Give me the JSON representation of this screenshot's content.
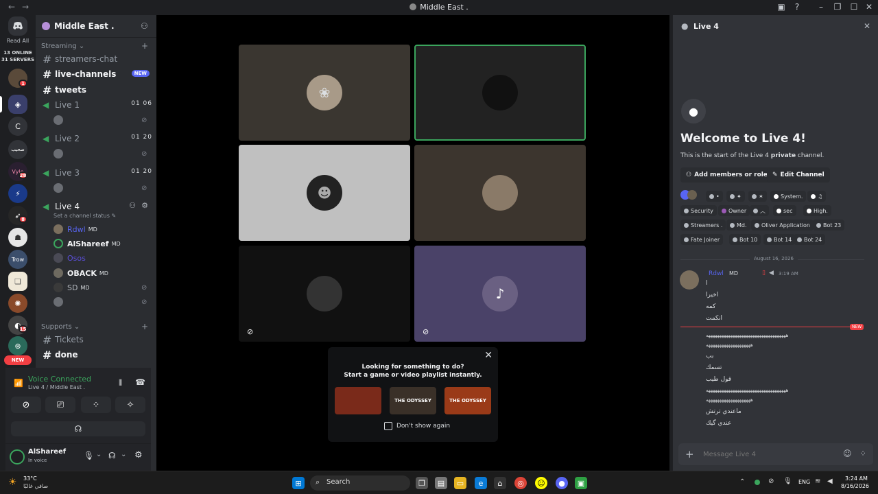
{
  "window": {
    "title": "Middle East .",
    "back": "←",
    "forward": "→"
  },
  "rail": {
    "read_all": "Read All",
    "online": "13 ONLINE",
    "servers": "31 SERVERS",
    "badges": [
      "1",
      "28",
      "8",
      "15"
    ],
    "c_label": "C",
    "arabic_label": "صحيب",
    "trow_label": "Trow",
    "new_label": "NEW"
  },
  "sidebar": {
    "guild_name": "Middle East .",
    "categories": {
      "streaming": "Streaming",
      "supports": "Supports"
    },
    "channels": {
      "streamers_chat": "streamers-chat",
      "live_channels": "live-channels",
      "new_badge": "NEW",
      "tweets": "tweets",
      "tickets": "Tickets",
      "done": "done"
    },
    "voice": [
      {
        "name": "Live 1",
        "count": "01 06"
      },
      {
        "name": "Live 2",
        "count": "01 20"
      },
      {
        "name": "Live 3",
        "count": "01 20"
      },
      {
        "name": "Live 4"
      }
    ],
    "live4_status": "Set a channel status",
    "members": [
      {
        "name": "Rdwl",
        "tag": "MD"
      },
      {
        "name": "AlShareef",
        "tag": "MD"
      },
      {
        "name": "Osos",
        "tag": ""
      },
      {
        "name": "OBACK",
        "tag": "MD"
      },
      {
        "name": "SD",
        "tag": "MD"
      }
    ]
  },
  "voice_panel": {
    "status": "Voice Connected",
    "location": "Live 4 / Middle East .",
    "user_name": "AlShareef",
    "user_status": "In voice"
  },
  "activity": {
    "line1": "Looking for something to do?",
    "line2": "Start a game or video playlist instantly.",
    "games": [
      "",
      "THE ODYSSEY",
      "THE ODYSSEY"
    ],
    "dont_show": "Don't show again"
  },
  "chat": {
    "header": "Live 4",
    "welcome": "Welcome to Live 4!",
    "intro_prefix": "This is the start of the Live 4 ",
    "intro_bold": "private",
    "intro_suffix": " channel.",
    "add_members": "Add members or roles",
    "edit_channel": "Edit Channel",
    "tags": [
      "•",
      "✦",
      "✶",
      "System.",
      "♫",
      "Security",
      "Owner",
      "︿",
      "sec",
      "High.",
      "Streamers .",
      "Md.",
      "Oliver Application",
      "Bot 23",
      "Fate Joiner",
      "Bot 10",
      "Bot 14",
      "Bot 24"
    ],
    "date_divider": "August 16, 2026",
    "message": {
      "author": "Rdwl",
      "role": "MD",
      "time": "3:19 AM",
      "lines": [
        "ا",
        "اخيرا",
        "كمه",
        "انكمت"
      ],
      "new_badge": "NEW",
      "lines2": [
        "ههههههههههههههههههههههههههههههههههههه",
        "ههههههههههههههههههههه",
        "بب",
        "تسمك",
        "قول طيب",
        "ههههههههههههههههههههههههههههههههههههه",
        "ههههههههههههههههههههه",
        "ماعندي ترتش",
        "عندي گيك"
      ]
    },
    "input_placeholder": "Message Live 4"
  },
  "taskbar": {
    "weather_temp": "33°C",
    "weather_desc": "صافي غالبًا",
    "search": "Search",
    "lang": "ENG",
    "time": "3:24 AM",
    "date": "8/16/2026"
  }
}
